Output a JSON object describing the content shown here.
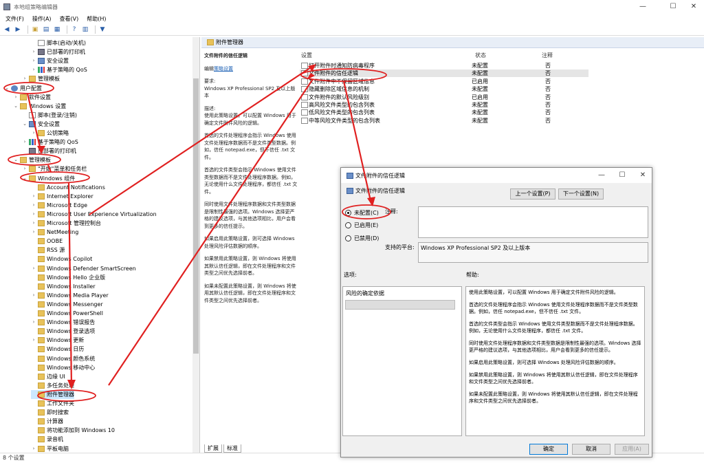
{
  "window": {
    "title": "本地组策略编辑器",
    "minimize": "—",
    "maximize": "☐",
    "close": "✕"
  },
  "menu": [
    "文件(F)",
    "操作(A)",
    "查看(V)",
    "帮助(H)"
  ],
  "tree": [
    {
      "label": "脚本(启动/关机)",
      "indent": 3,
      "icon": "doc",
      "exp": ""
    },
    {
      "label": "已部署的打印机",
      "indent": 3,
      "icon": "printer",
      "exp": "›"
    },
    {
      "label": "安全设置",
      "indent": 3,
      "icon": "shield",
      "exp": "›"
    },
    {
      "label": "基于策略的 QoS",
      "indent": 3,
      "icon": "bars",
      "exp": "›"
    },
    {
      "label": "管理模板",
      "indent": 2,
      "icon": "folder",
      "exp": "›"
    },
    {
      "label": "用户配置",
      "indent": 0,
      "icon": "user",
      "exp": "⌄"
    },
    {
      "label": "软件设置",
      "indent": 1,
      "icon": "folder",
      "exp": "›"
    },
    {
      "label": "Windows 设置",
      "indent": 1,
      "icon": "folder",
      "exp": "⌄"
    },
    {
      "label": "脚本(登录/注销)",
      "indent": 2,
      "icon": "doc",
      "exp": ""
    },
    {
      "label": "安全设置",
      "indent": 2,
      "icon": "shield",
      "exp": "⌄"
    },
    {
      "label": "公钥策略",
      "indent": 3,
      "icon": "folder",
      "exp": "›"
    },
    {
      "label": "基于策略的 QoS",
      "indent": 2,
      "icon": "bars",
      "exp": "›"
    },
    {
      "label": "已部署的打印机",
      "indent": 2,
      "icon": "printer",
      "exp": ""
    },
    {
      "label": "管理模板",
      "indent": 1,
      "icon": "folder",
      "exp": "⌄"
    },
    {
      "label": "\"开始\"菜单和任务栏",
      "indent": 2,
      "icon": "folder",
      "exp": "›"
    },
    {
      "label": "Windows 组件",
      "indent": 2,
      "icon": "folder",
      "exp": "⌄"
    },
    {
      "label": "Account Notifications",
      "indent": 3,
      "icon": "folder",
      "exp": ""
    },
    {
      "label": "Internet Explorer",
      "indent": 3,
      "icon": "folder",
      "exp": "›"
    },
    {
      "label": "Microsoft Edge",
      "indent": 3,
      "icon": "folder",
      "exp": "›"
    },
    {
      "label": "Microsoft User Experience Virtualization",
      "indent": 3,
      "icon": "folder",
      "exp": "›"
    },
    {
      "label": "Microsoft 管理控制台",
      "indent": 3,
      "icon": "folder",
      "exp": "›"
    },
    {
      "label": "NetMeeting",
      "indent": 3,
      "icon": "folder",
      "exp": "›"
    },
    {
      "label": "OOBE",
      "indent": 3,
      "icon": "folder",
      "exp": ""
    },
    {
      "label": "RSS 源",
      "indent": 3,
      "icon": "folder",
      "exp": ""
    },
    {
      "label": "Windows Copilot",
      "indent": 3,
      "icon": "folder",
      "exp": ""
    },
    {
      "label": "Windows Defender SmartScreen",
      "indent": 3,
      "icon": "folder",
      "exp": "›"
    },
    {
      "label": "Windows Hello 企业版",
      "indent": 3,
      "icon": "folder",
      "exp": ""
    },
    {
      "label": "Windows Installer",
      "indent": 3,
      "icon": "folder",
      "exp": ""
    },
    {
      "label": "Windows Media Player",
      "indent": 3,
      "icon": "folder",
      "exp": "›"
    },
    {
      "label": "Windows Messenger",
      "indent": 3,
      "icon": "folder",
      "exp": ""
    },
    {
      "label": "Windows PowerShell",
      "indent": 3,
      "icon": "folder",
      "exp": ""
    },
    {
      "label": "Windows 错误报告",
      "indent": 3,
      "icon": "folder",
      "exp": "›"
    },
    {
      "label": "Windows 登录选项",
      "indent": 3,
      "icon": "folder",
      "exp": ""
    },
    {
      "label": "Windows 更新",
      "indent": 3,
      "icon": "folder",
      "exp": "›"
    },
    {
      "label": "Windows 日历",
      "indent": 3,
      "icon": "folder",
      "exp": ""
    },
    {
      "label": "Windows 颜色系统",
      "indent": 3,
      "icon": "folder",
      "exp": ""
    },
    {
      "label": "Windows 移动中心",
      "indent": 3,
      "icon": "folder",
      "exp": ""
    },
    {
      "label": "边缘 UI",
      "indent": 3,
      "icon": "folder",
      "exp": ""
    },
    {
      "label": "多任务处理",
      "indent": 3,
      "icon": "folder",
      "exp": ""
    },
    {
      "label": "附件管理器",
      "indent": 3,
      "icon": "folder",
      "exp": "",
      "selected": true
    },
    {
      "label": "工作文件夹",
      "indent": 3,
      "icon": "folder",
      "exp": ""
    },
    {
      "label": "即时搜索",
      "indent": 3,
      "icon": "folder",
      "exp": ""
    },
    {
      "label": "计算器",
      "indent": 3,
      "icon": "folder",
      "exp": ""
    },
    {
      "label": "将功能添加到 Windows 10",
      "indent": 3,
      "icon": "folder",
      "exp": ""
    },
    {
      "label": "录音机",
      "indent": 3,
      "icon": "folder",
      "exp": ""
    },
    {
      "label": "平板电脑",
      "indent": 3,
      "icon": "folder",
      "exp": "›"
    }
  ],
  "right": {
    "header": "附件管理器",
    "desc_title": "文件附件的信任逻辑",
    "edit_prefix": "编辑",
    "edit_link": "策略设置",
    "req_label": "要求:",
    "req": "Windows XP Professional SP2 及以上版本",
    "desc_label": "描述:",
    "desc_paras": [
      "使用此策略设置，可以配置 Windows 用于确定文件附件风险的逻辑。",
      "首选的文件处理程序会指示 Windows 使用文件处理程序数据而不是文件类型数据。例如，信任 notepad.exe，但不信任 .txt 文件。",
      "首选的文件类型会指示 Windows 使用文件类型数据而不是文件处理程序数据。例如，无论使用什么文件处理程序，都信任 .txt 文件。",
      "同时使用文件处理程序数据和文件类型数据是限制性最强的选项。Windows 选择更严格的建议选项，与其他选项相比，用户会看到更多的信任提示。",
      "如果启用此策略设置，则可选择 Windows 处理风险评估数据的顺序。",
      "如果禁用此策略设置，则 Windows 将使用其默认信任逻辑，即在文件处理程序和文件类型之间优先选择前者。",
      "如果未配置此策略设置，则 Windows 将使用其默认信任逻辑，即在文件处理程序和文件类型之间优先选择前者。"
    ],
    "columns": {
      "setting": "设置",
      "state": "状态",
      "comment": "注释"
    },
    "rows": [
      {
        "name": "打开附件时通知防病毒程序",
        "state": "未配置",
        "comment": "否"
      },
      {
        "name": "文件附件的信任逻辑",
        "state": "未配置",
        "comment": "否",
        "selected": true
      },
      {
        "name": "文件附件中不保留区域信息",
        "state": "已启用",
        "comment": "否"
      },
      {
        "name": "隐藏删除区域信息的机制",
        "state": "未配置",
        "comment": "否"
      },
      {
        "name": "文件附件的默认风险级别",
        "state": "已启用",
        "comment": "否"
      },
      {
        "name": "高风险文件类型的包含列表",
        "state": "未配置",
        "comment": "否"
      },
      {
        "name": "低风险文件类型的包含列表",
        "state": "未配置",
        "comment": "否"
      },
      {
        "name": "中等风险文件类型的包含列表",
        "state": "未配置",
        "comment": "否"
      }
    ],
    "tabs": [
      "扩展",
      "标准"
    ]
  },
  "status": "8 个设置",
  "dialog": {
    "title": "文件附件的信任逻辑",
    "subtitle": "文件附件的信任逻辑",
    "prev": "上一个设置(P)",
    "next": "下一个设置(N)",
    "radios": [
      "未配置(C)",
      "已启用(E)",
      "已禁用(D)"
    ],
    "selected_radio": 0,
    "comment_label": "注释:",
    "supported_label": "支持的平台:",
    "supported_value": "Windows XP Professional SP2 及以上版本",
    "options_label": "选项:",
    "help_label": "帮助:",
    "option_name": "风险的确定依据",
    "help_paras": [
      "使用此策略设置，可以配置 Windows 用于确定文件附件风险的逻辑。",
      "首选的文件处理程序会指示 Windows 使用文件处理程序数据而不是文件类型数据。例如，信任 notepad.exe，但不信任 .txt 文件。",
      "首选的文件类型会指示 Windows 使用文件类型数据而不是文件处理程序数据。例如，无论使用什么文件处理程序，都信任 .txt 文件。",
      "同时使用文件处理程序数据和文件类型数据是限制性最强的选项。Windows 选择更严格的建议选项，与其他选项相比，用户会看到更多的信任提示。",
      "如果启用此策略设置，则可选择 Windows 处理风险评估数据的顺序。",
      "如果禁用此策略设置，则 Windows 将使用其默认信任逻辑，即在文件处理程序和文件类型之间优先选择前者。",
      "如果未配置此策略设置，则 Windows 将使用其默认信任逻辑，即在文件处理程序和文件类型之间优先选择前者。"
    ],
    "ok": "确定",
    "cancel": "取消",
    "apply": "应用(A)"
  },
  "colors": {
    "annotation_red": "#e02020",
    "link": "#1a5fb4",
    "selection": "#e5e5e5"
  }
}
